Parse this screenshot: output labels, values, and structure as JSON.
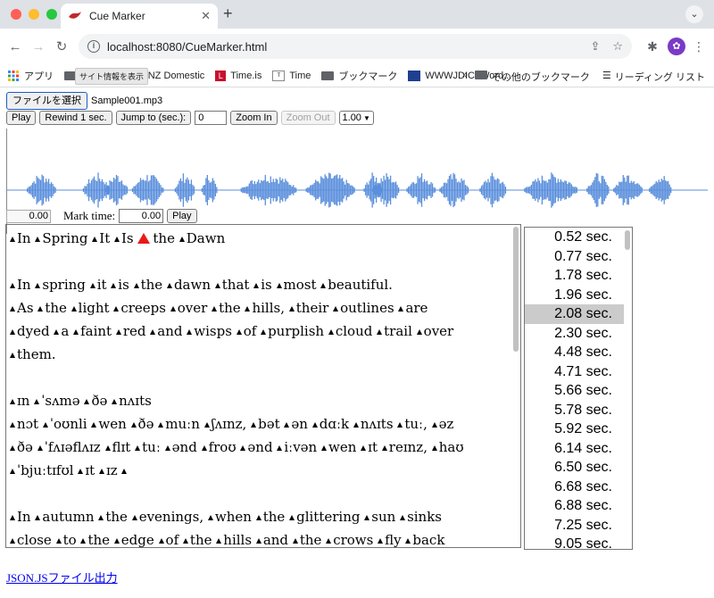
{
  "browser": {
    "tab_title": "Cue Marker",
    "url": "localhost:8080/CueMarker.html",
    "tooltip": "サイト情報を表示",
    "bookmarks": [
      {
        "label": "アプリ",
        "icon": "apps-grid-icon"
      },
      {
        "label": "F",
        "icon": "folder-icon"
      },
      {
        "label": "NZ Domestic",
        "icon": "folder-icon"
      },
      {
        "label": "Time.is",
        "icon": "time-is-icon"
      },
      {
        "label": "Time",
        "icon": "time-icon"
      },
      {
        "label": "ブックマーク",
        "icon": "folder-icon"
      },
      {
        "label": "WWWJDIC: Word...",
        "icon": "wwwjdic-icon"
      }
    ],
    "bookmarks_right": {
      "more": "»",
      "other": "その他のブックマーク",
      "reading_list": "リーディング リスト"
    }
  },
  "controls": {
    "file_button": "ファイルを選択",
    "file_name": "Sample001.mp3",
    "play": "Play",
    "rewind": "Rewind 1 sec.",
    "jump": "Jump to (sec.):",
    "jump_value": "0",
    "zoom_in": "Zoom In",
    "zoom_out": "Zoom Out",
    "speed": "1.00"
  },
  "mark": {
    "current_time": "0.00",
    "label": "Mark time:",
    "value": "0.00",
    "play": "Play"
  },
  "text_lines": [
    {
      "tokens": [
        "In",
        "Spring",
        "It",
        "Is",
        "the",
        "Dawn"
      ],
      "red_index": 4
    },
    {
      "tokens": []
    },
    {
      "tokens": [
        "In",
        "spring",
        "it",
        "is",
        "the",
        "dawn",
        "that",
        "is",
        "most",
        "beautiful."
      ]
    },
    {
      "tokens": [
        "As",
        "the",
        "light",
        "creeps",
        "over",
        "the",
        "hills,",
        "their",
        "outlines",
        "are"
      ]
    },
    {
      "tokens": [
        "dyed",
        "a",
        "faint",
        "red",
        "and",
        "wisps",
        "of",
        "purplish",
        "cloud",
        "trail",
        "over"
      ]
    },
    {
      "tokens": [
        "them."
      ]
    },
    {
      "tokens": []
    },
    {
      "tokens": [
        "ɪn",
        "ˈsʌmə",
        "ðə",
        "nʌɪts"
      ]
    },
    {
      "tokens": [
        "nɔt",
        "ˈoʊnli",
        "wen",
        "ðə",
        "muːn",
        "ʃʌɪnz,",
        "bət",
        "ən",
        "dɑːk",
        "nʌɪts",
        "tuː,",
        "əz"
      ]
    },
    {
      "tokens": [
        "ðə",
        "ˈfʌɪəflʌɪz",
        "flɪt",
        "tuː",
        "ənd",
        "froʊ",
        "ənd",
        "iːvən",
        "wen",
        "ɪt",
        "reɪnz,",
        "haʊ"
      ]
    },
    {
      "tokens": [
        "ˈbjuːtɪfʊl",
        "ɪt",
        "ɪz"
      ],
      "trailing_marker": true
    },
    {
      "tokens": []
    },
    {
      "tokens": [
        "In",
        "autumn",
        "the",
        "evenings,",
        "when",
        "the",
        "glittering",
        "sun",
        "sinks"
      ]
    },
    {
      "tokens": [
        "close",
        "to",
        "the",
        "edge",
        "of",
        "the",
        "hills",
        "and",
        "the",
        "crows",
        "fly",
        "back"
      ]
    }
  ],
  "cue_list": [
    "0.52 sec.",
    "0.77 sec.",
    "1.78 sec.",
    "1.96 sec.",
    "2.08 sec.",
    "2.30 sec.",
    "4.48 sec.",
    "4.71 sec.",
    "5.66 sec.",
    "5.78 sec.",
    "5.92 sec.",
    "6.14 sec.",
    "6.50 sec.",
    "6.68 sec.",
    "6.88 sec.",
    "7.25 sec.",
    "9.05 sec."
  ],
  "selected_cue": 4,
  "export_link": "JSON.JSファイル出力",
  "colors": {
    "waveform": "#5b8fdc",
    "marker_red": "#e81a1a",
    "selection": "#cbcbcb"
  }
}
